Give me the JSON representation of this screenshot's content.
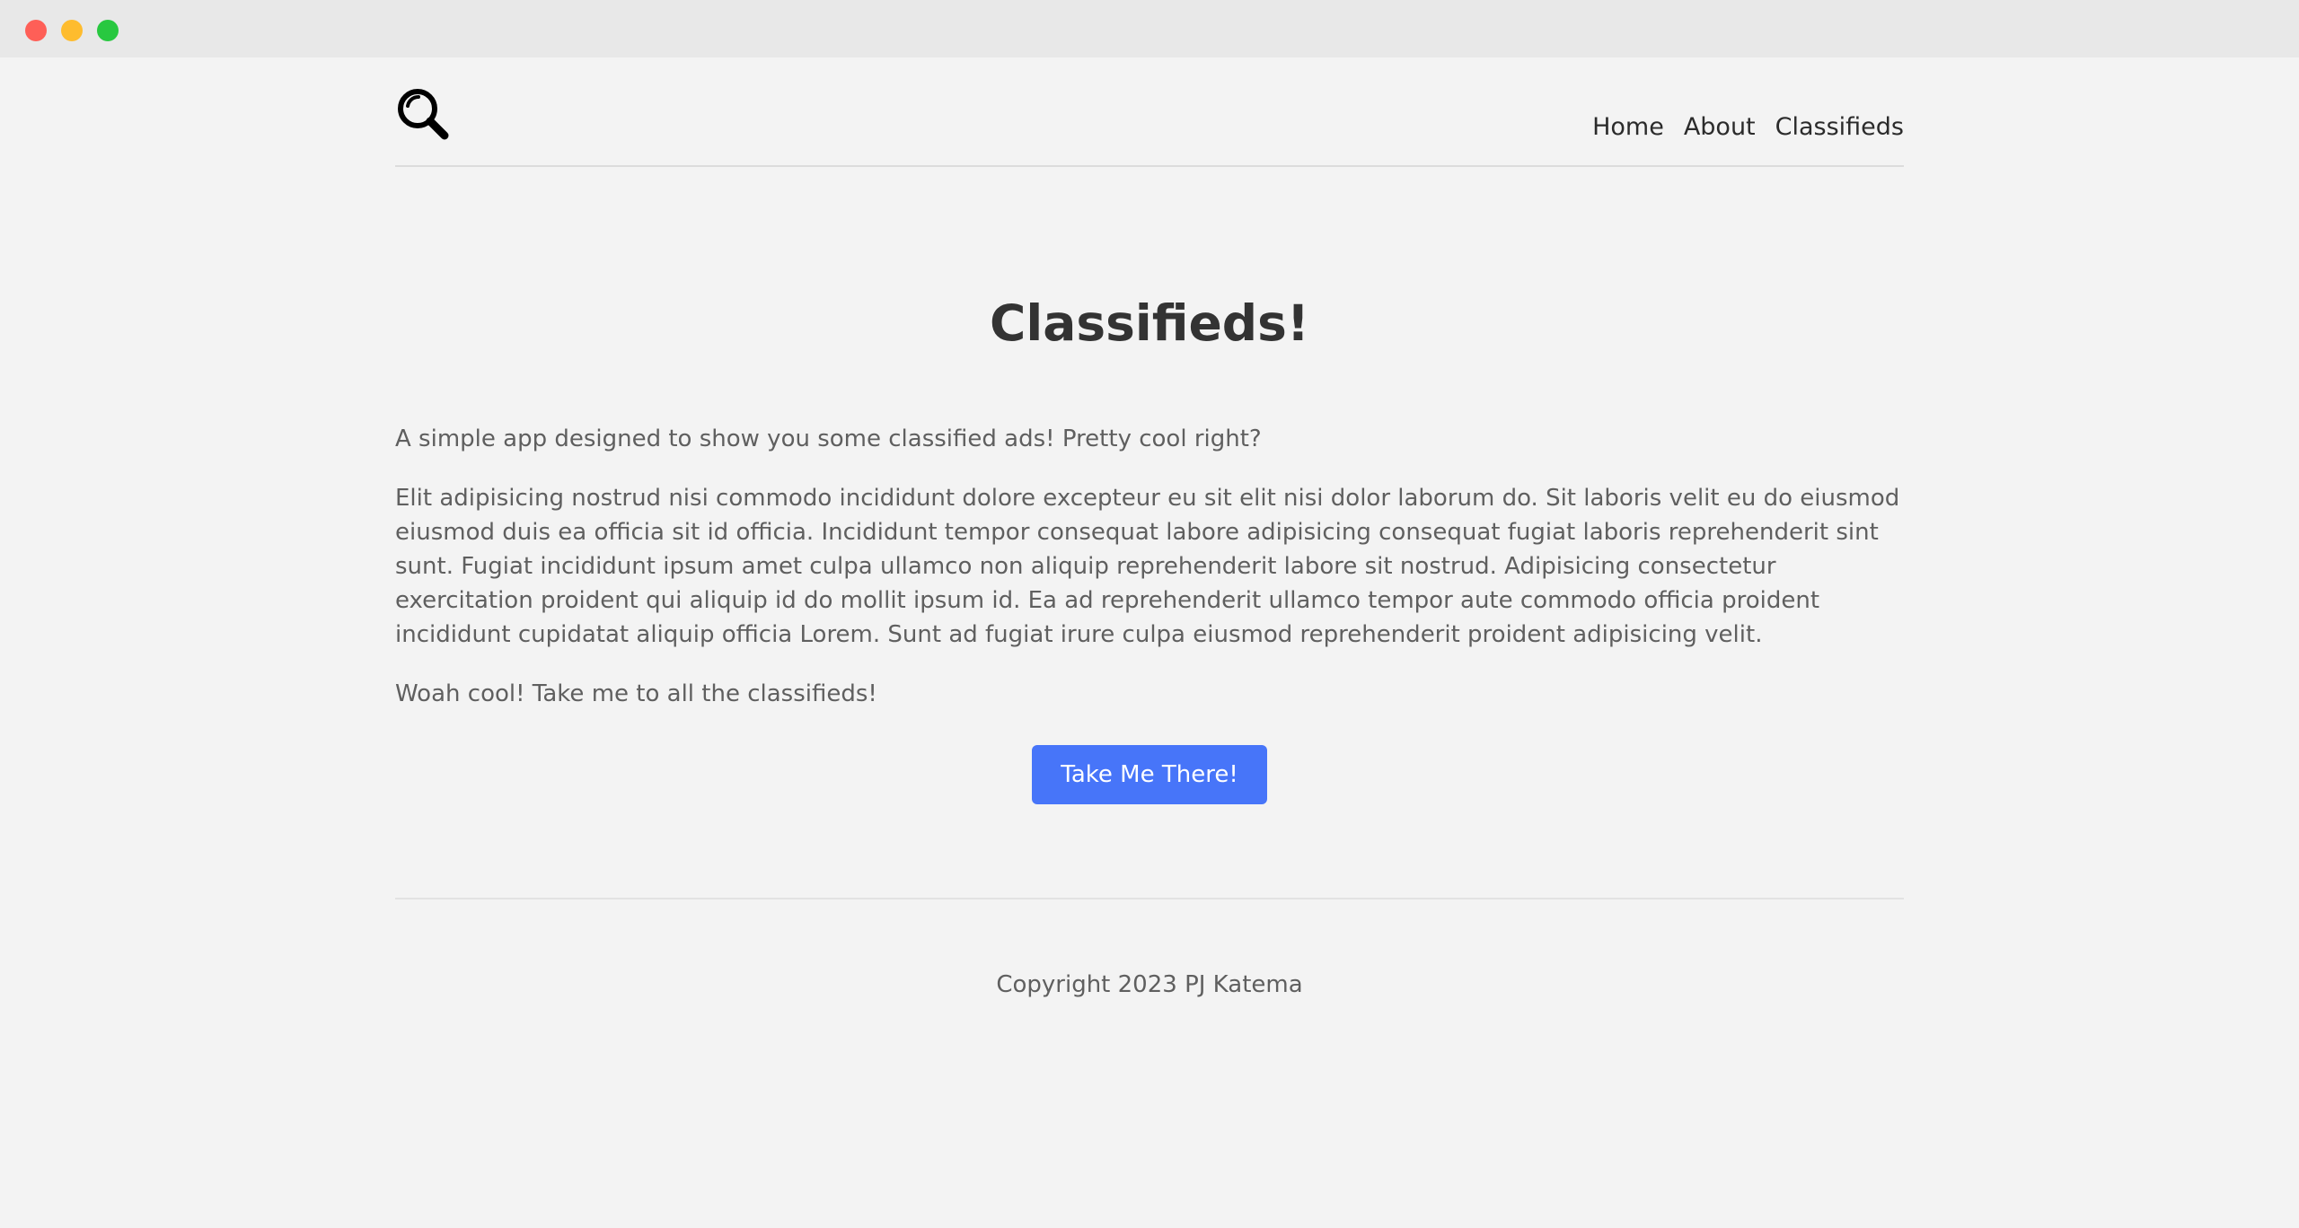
{
  "nav": {
    "logo_icon": "magnifying-glass-icon",
    "links": [
      "Home",
      "About",
      "Classifieds"
    ]
  },
  "main": {
    "title": "Classifieds!",
    "intro": "A simple app designed to show you some classified ads! Pretty cool right?",
    "body": "Elit adipisicing nostrud nisi commodo incididunt dolore excepteur eu sit elit nisi dolor laborum do. Sit laboris velit eu do eiusmod eiusmod duis ea officia sit id officia. Incididunt tempor consequat labore adipisicing consequat fugiat laboris reprehenderit sint sunt. Fugiat incididunt ipsum amet culpa ullamco non aliquip reprehenderit labore sit nostrud. Adipisicing consectetur exercitation proident qui aliquip id do mollit ipsum id. Ea ad reprehenderit ullamco tempor aute commodo officia proident incididunt cupidatat aliquip officia Lorem. Sunt ad fugiat irure culpa eiusmod reprehenderit proident adipisicing velit.",
    "prompt": "Woah cool! Take me to all the classifieds!",
    "cta_label": "Take Me There!"
  },
  "footer": {
    "copyright": "Copyright 2023 PJ Katema"
  },
  "colors": {
    "background": "#f3f3f3",
    "accent": "#4775f9",
    "title": "#333333",
    "body_text": "#5f5f5f"
  }
}
